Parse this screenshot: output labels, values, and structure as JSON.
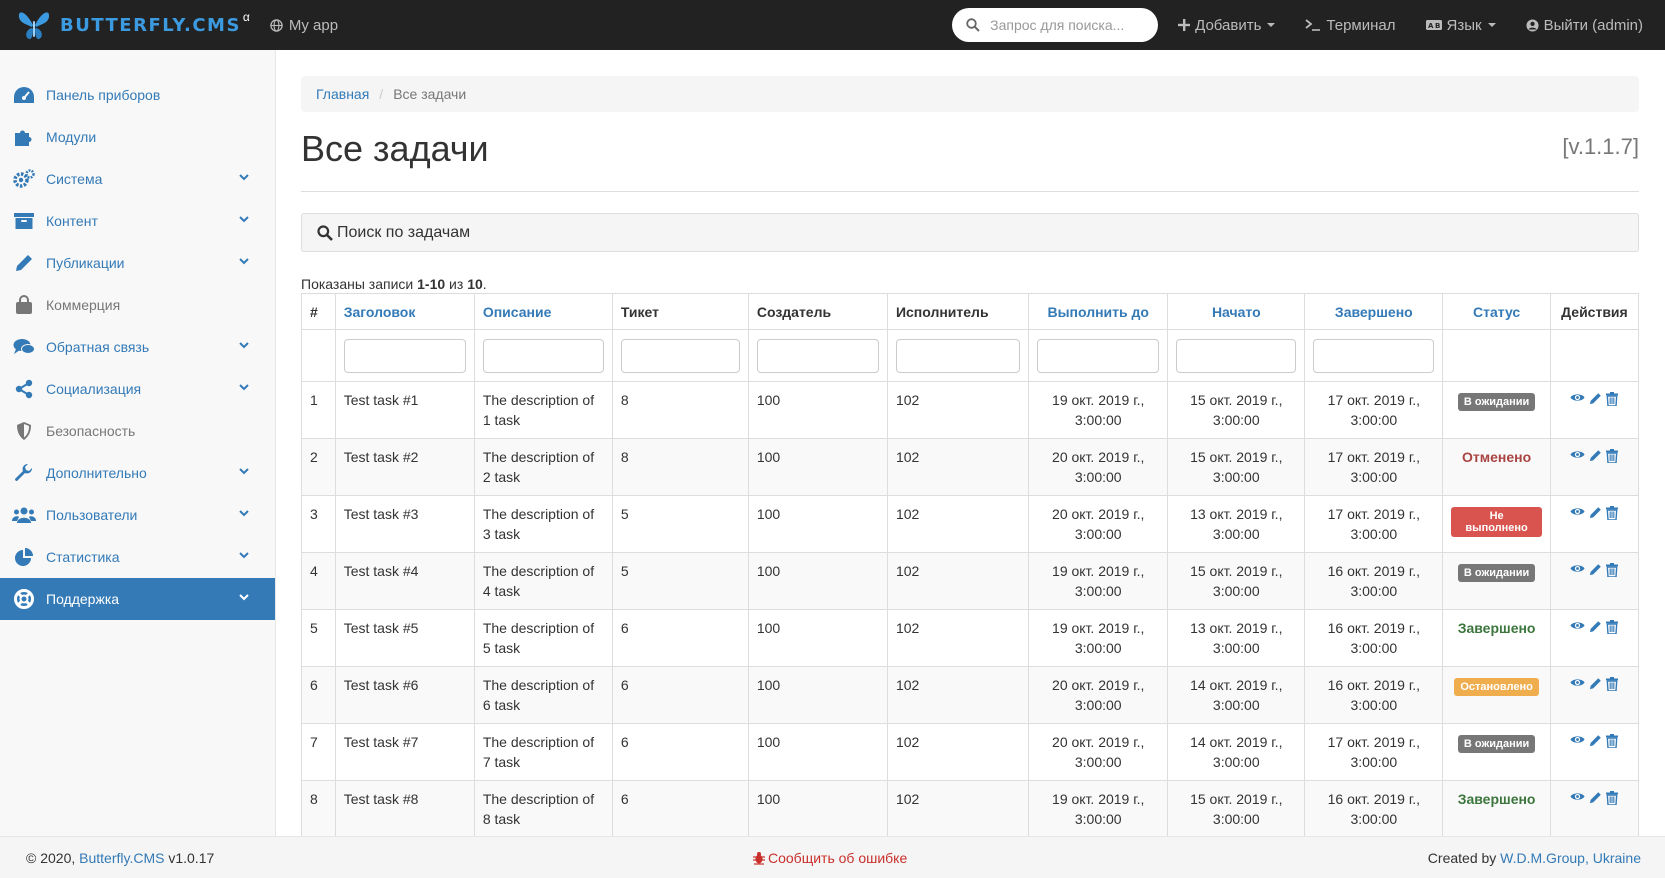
{
  "colors": {
    "navbar_bg": "#222222",
    "brand": "#3c9ae0",
    "link": "#337ab7",
    "active_bg": "#337ab7",
    "status_pending": "#777777",
    "status_canceled": "#a94442",
    "status_failed": "#d9534f",
    "status_done": "#3c763d",
    "status_stopped": "#f0ad4e",
    "report_bug": "#c9302c"
  },
  "navbar": {
    "brand_name": "BUTTERFLY.CMS",
    "brand_alpha": "α",
    "app_name": "My app",
    "search_placeholder": "Запрос для поиска...",
    "add_label": "Добавить",
    "terminal_label": "Терминал",
    "language_label": "Язык",
    "logout_label": "Выйти (admin)"
  },
  "sidebar": {
    "items": [
      {
        "label": "Панель приборов",
        "icon": "dashboard-icon"
      },
      {
        "label": "Модули",
        "icon": "puzzle-icon"
      },
      {
        "label": "Система",
        "icon": "cogs-icon"
      },
      {
        "label": "Контент",
        "icon": "archive-icon"
      },
      {
        "label": "Публикации",
        "icon": "pencil-icon"
      },
      {
        "label": "Коммерция",
        "icon": "shopping-bag-icon"
      },
      {
        "label": "Обратная связь",
        "icon": "comments-icon"
      },
      {
        "label": "Социализация",
        "icon": "share-icon"
      },
      {
        "label": "Безопасность",
        "icon": "shield-icon"
      },
      {
        "label": "Дополнительно",
        "icon": "wrench-icon"
      },
      {
        "label": "Пользователи",
        "icon": "users-icon"
      },
      {
        "label": "Статистика",
        "icon": "pie-chart-icon"
      },
      {
        "label": "Поддержка",
        "icon": "life-ring-icon"
      }
    ]
  },
  "breadcrumb": {
    "home": "Главная",
    "current": "Все задачи"
  },
  "page": {
    "title": "Все задачи",
    "version": "[v.1.1.7]",
    "search_panel_title": "Поиск по задачам",
    "summary_prefix": "Показаны записи ",
    "summary_range": "1-10",
    "summary_of": " из ",
    "summary_total": "10",
    "summary_suffix": "."
  },
  "table": {
    "headers": [
      "#",
      "Заголовок",
      "Описание",
      "Тикет",
      "Создатель",
      "Исполнитель",
      "Выполнить до",
      "Начато",
      "Завершено",
      "Статус",
      "Действия"
    ],
    "rows": [
      {
        "num": "1",
        "title": "Test task #1",
        "desc": "The description of 1 task",
        "ticket": "8",
        "creator": "100",
        "executor": "102",
        "due": "19 окт. 2019 г., 3:00:00",
        "started": "15 окт. 2019 г., 3:00:00",
        "finished": "17 окт. 2019 г., 3:00:00",
        "status": "В ожидании"
      },
      {
        "num": "2",
        "title": "Test task #2",
        "desc": "The description of 2 task",
        "ticket": "8",
        "creator": "100",
        "executor": "102",
        "due": "20 окт. 2019 г., 3:00:00",
        "started": "15 окт. 2019 г., 3:00:00",
        "finished": "17 окт. 2019 г., 3:00:00",
        "status": "Отменено"
      },
      {
        "num": "3",
        "title": "Test task #3",
        "desc": "The description of 3 task",
        "ticket": "5",
        "creator": "100",
        "executor": "102",
        "due": "20 окт. 2019 г., 3:00:00",
        "started": "13 окт. 2019 г., 3:00:00",
        "finished": "17 окт. 2019 г., 3:00:00",
        "status": "Не выполнено"
      },
      {
        "num": "4",
        "title": "Test task #4",
        "desc": "The description of 4 task",
        "ticket": "5",
        "creator": "100",
        "executor": "102",
        "due": "19 окт. 2019 г., 3:00:00",
        "started": "15 окт. 2019 г., 3:00:00",
        "finished": "16 окт. 2019 г., 3:00:00",
        "status": "В ожидании"
      },
      {
        "num": "5",
        "title": "Test task #5",
        "desc": "The description of 5 task",
        "ticket": "6",
        "creator": "100",
        "executor": "102",
        "due": "19 окт. 2019 г., 3:00:00",
        "started": "13 окт. 2019 г., 3:00:00",
        "finished": "16 окт. 2019 г., 3:00:00",
        "status": "Завершено"
      },
      {
        "num": "6",
        "title": "Test task #6",
        "desc": "The description of 6 task",
        "ticket": "6",
        "creator": "100",
        "executor": "102",
        "due": "20 окт. 2019 г., 3:00:00",
        "started": "14 окт. 2019 г., 3:00:00",
        "finished": "16 окт. 2019 г., 3:00:00",
        "status": "Остановлено"
      },
      {
        "num": "7",
        "title": "Test task #7",
        "desc": "The description of 7 task",
        "ticket": "6",
        "creator": "100",
        "executor": "102",
        "due": "20 окт. 2019 г., 3:00:00",
        "started": "14 окт. 2019 г., 3:00:00",
        "finished": "17 окт. 2019 г., 3:00:00",
        "status": "В ожидании"
      },
      {
        "num": "8",
        "title": "Test task #8",
        "desc": "The description of 8 task",
        "ticket": "6",
        "creator": "100",
        "executor": "102",
        "due": "19 окт. 2019 г., 3:00:00",
        "started": "15 окт. 2019 г., 3:00:00",
        "finished": "16 окт. 2019 г., 3:00:00",
        "status": "Завершено"
      }
    ]
  },
  "footer": {
    "copyright": "© 2020, ",
    "cms_link": "Butterfly.CMS",
    "cms_version": " v1.0.17",
    "report_bug": "Сообщить об ошибке",
    "created_by": "Created by ",
    "author_link": "W.D.M.Group, Ukraine"
  }
}
